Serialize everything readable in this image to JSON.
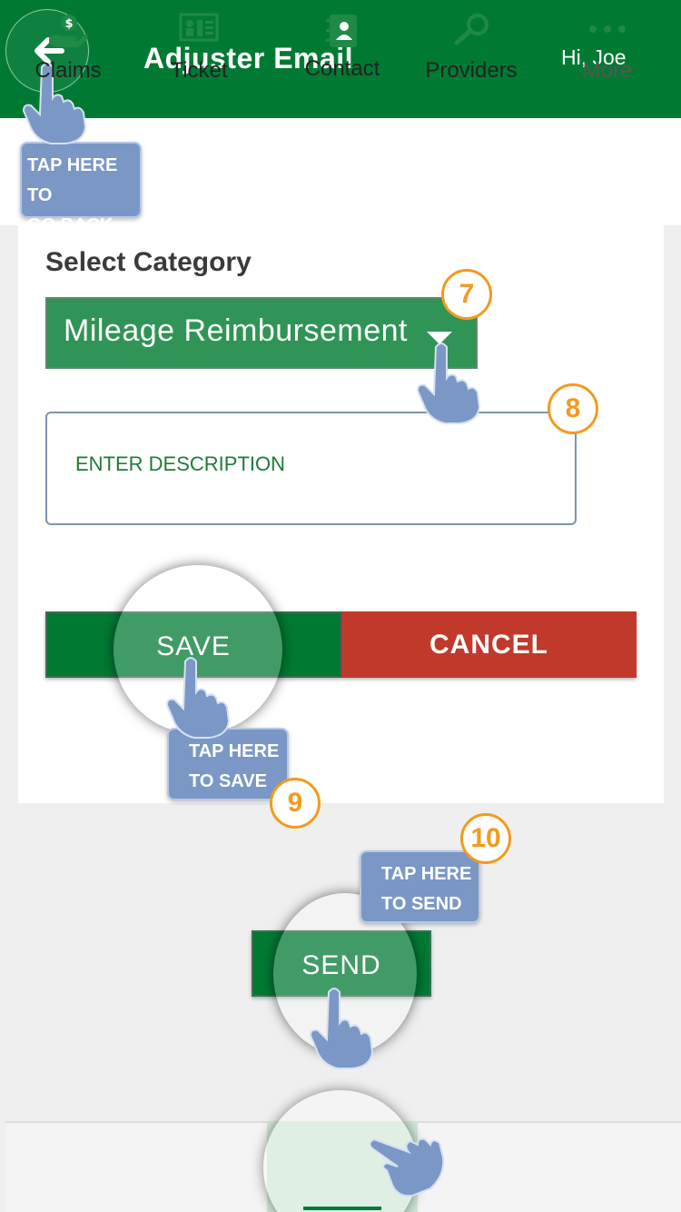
{
  "header": {
    "title": "Adjuster Email",
    "greeting": "Hi, Joe"
  },
  "tips": {
    "back_line1": "TAP HERE TO",
    "back_line2": "GO BACK",
    "save_line1": "TAP HERE",
    "save_line2": "TO SAVE",
    "send_line1": "TAP HERE",
    "send_line2": "TO SEND"
  },
  "form": {
    "category_label": "Select Category",
    "category_value": "Mileage Reimbursement",
    "description_placeholder": "ENTER DESCRIPTION"
  },
  "buttons": {
    "save": "SAVE",
    "cancel": "CANCEL",
    "send": "SEND"
  },
  "steps": {
    "dropdown": "7",
    "description": "8",
    "save": "9",
    "send": "10"
  },
  "tabs": [
    {
      "label": "Claims",
      "icon": "hand-money-icon"
    },
    {
      "label": "Ticket",
      "icon": "ticket-icon"
    },
    {
      "label": "Contact",
      "icon": "contact-book-icon",
      "active": true
    },
    {
      "label": "Providers",
      "icon": "search-icon"
    },
    {
      "label": "More",
      "icon": "more-dots-icon"
    }
  ],
  "colors": {
    "brand_green": "#007a33",
    "cancel_red": "#c0392b",
    "step_orange": "#f39a1e",
    "tip_blue": "#7a97c6"
  }
}
